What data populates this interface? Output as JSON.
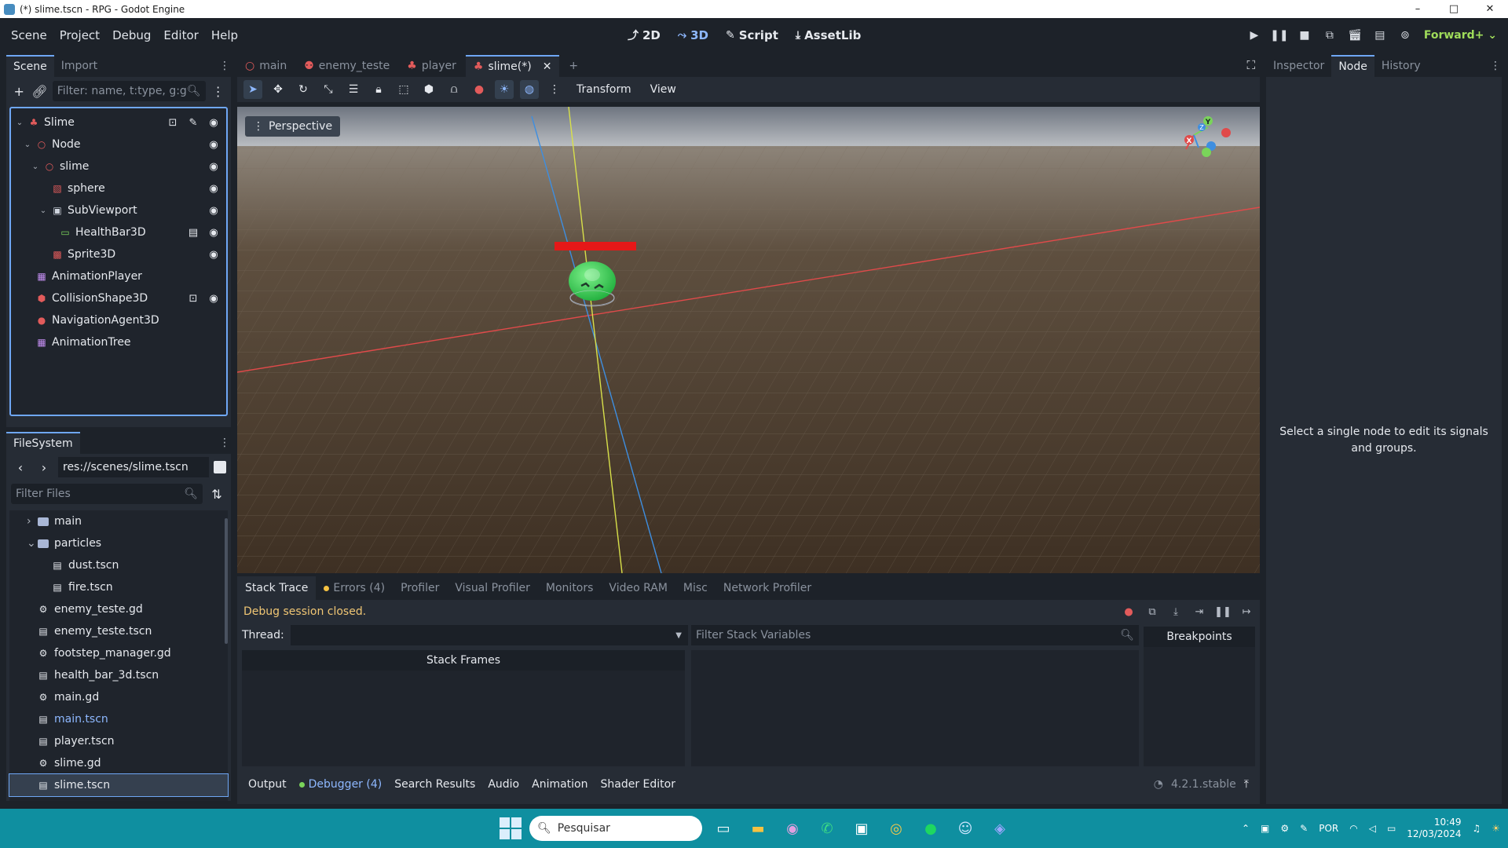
{
  "window": {
    "title": "(*) slime.tscn - RPG - Godot Engine",
    "controls": [
      "–",
      "□",
      "✕"
    ]
  },
  "menubar": {
    "menus": [
      "Scene",
      "Project",
      "Debug",
      "Editor",
      "Help"
    ],
    "workspaces": [
      {
        "label": "2D",
        "glyph": "⤴"
      },
      {
        "label": "3D",
        "glyph": "⤳"
      },
      {
        "label": "Script",
        "glyph": "✎"
      },
      {
        "label": "AssetLib",
        "glyph": "⤓"
      }
    ],
    "active_workspace": "3D",
    "renderer": "Forward+"
  },
  "scene_dock": {
    "tabs": [
      "Scene",
      "Import"
    ],
    "filter_placeholder": "Filter: name, t:type, g:g",
    "nodes": [
      {
        "label": "Slime",
        "depth": 0,
        "expanded": true,
        "icon_color": "#e25b5b",
        "icon": "♣"
      },
      {
        "label": "Node",
        "depth": 1,
        "expanded": true,
        "icon_color": "#e25b5b",
        "icon": "○"
      },
      {
        "label": "slime",
        "depth": 2,
        "expanded": true,
        "icon_color": "#e25b5b",
        "icon": "○"
      },
      {
        "label": "sphere",
        "depth": 3,
        "icon_color": "#e25b5b",
        "icon": "▧"
      },
      {
        "label": "SubViewport",
        "depth": 3,
        "expanded": true,
        "icon_color": "#cfd5de",
        "icon": "▣"
      },
      {
        "label": "HealthBar3D",
        "depth": 4,
        "icon_color": "#7ad45a",
        "icon": "▭"
      },
      {
        "label": "Sprite3D",
        "depth": 3,
        "icon_color": "#e25b5b",
        "icon": "▩"
      },
      {
        "label": "AnimationPlayer",
        "depth": 1,
        "icon_color": "#c38ef1",
        "icon": "▦"
      },
      {
        "label": "CollisionShape3D",
        "depth": 1,
        "icon_color": "#e25b5b",
        "icon": "⬢"
      },
      {
        "label": "NavigationAgent3D",
        "depth": 1,
        "icon_color": "#e25b5b",
        "icon": "●"
      },
      {
        "label": "AnimationTree",
        "depth": 1,
        "icon_color": "#c38ef1",
        "icon": "▦"
      }
    ]
  },
  "filesystem_dock": {
    "tab": "FileSystem",
    "path": "res://scenes/slime.tscn",
    "filter_placeholder": "Filter Files",
    "items": [
      {
        "label": "main",
        "kind": "folder",
        "depth": 1,
        "arrow": "›"
      },
      {
        "label": "particles",
        "kind": "folder",
        "depth": 1,
        "arrow": "⌄"
      },
      {
        "label": "dust.tscn",
        "kind": "scene",
        "depth": 2
      },
      {
        "label": "fire.tscn",
        "kind": "scene",
        "depth": 2
      },
      {
        "label": "enemy_teste.gd",
        "kind": "script",
        "depth": 1
      },
      {
        "label": "enemy_teste.tscn",
        "kind": "scene",
        "depth": 1
      },
      {
        "label": "footstep_manager.gd",
        "kind": "script",
        "depth": 1
      },
      {
        "label": "health_bar_3d.tscn",
        "kind": "scene",
        "depth": 1
      },
      {
        "label": "main.gd",
        "kind": "script",
        "depth": 1
      },
      {
        "label": "main.tscn",
        "kind": "scene",
        "depth": 1,
        "highlight": true
      },
      {
        "label": "player.tscn",
        "kind": "scene",
        "depth": 1
      },
      {
        "label": "slime.gd",
        "kind": "script",
        "depth": 1
      },
      {
        "label": "slime.tscn",
        "kind": "scene",
        "depth": 1,
        "selected": true
      }
    ]
  },
  "editor": {
    "scene_tabs": [
      {
        "label": "main",
        "icon": "○"
      },
      {
        "label": "enemy_teste",
        "icon": "⚉"
      },
      {
        "label": "player",
        "icon": "♣"
      },
      {
        "label": "slime(*)",
        "icon": "♣",
        "active": true
      }
    ],
    "viewport_menus": [
      "Transform",
      "View"
    ],
    "perspective_label": "Perspective",
    "gizmo_labels": {
      "x": "X",
      "y": "Y",
      "z": "Z"
    }
  },
  "debugger": {
    "tabs": [
      "Stack Trace",
      "Errors (4)",
      "Profiler",
      "Visual Profiler",
      "Monitors",
      "Video RAM",
      "Misc",
      "Network Profiler"
    ],
    "status": "Debug session closed.",
    "thread_label": "Thread:",
    "stack_frames_label": "Stack Frames",
    "filter_vars_placeholder": "Filter Stack Variables",
    "breakpoints_label": "Breakpoints"
  },
  "bottom_bar": {
    "items": [
      "Output",
      "Debugger (4)",
      "Search Results",
      "Audio",
      "Animation",
      "Shader Editor"
    ],
    "version": "4.2.1.stable"
  },
  "inspector_dock": {
    "tabs": [
      "Inspector",
      "Node",
      "History"
    ],
    "active_tab": "Node",
    "message": "Select a single node to edit its signals and groups."
  },
  "taskbar": {
    "search_placeholder": "Pesquisar",
    "language": "POR",
    "time": "10:49",
    "date": "12/03/2024"
  }
}
